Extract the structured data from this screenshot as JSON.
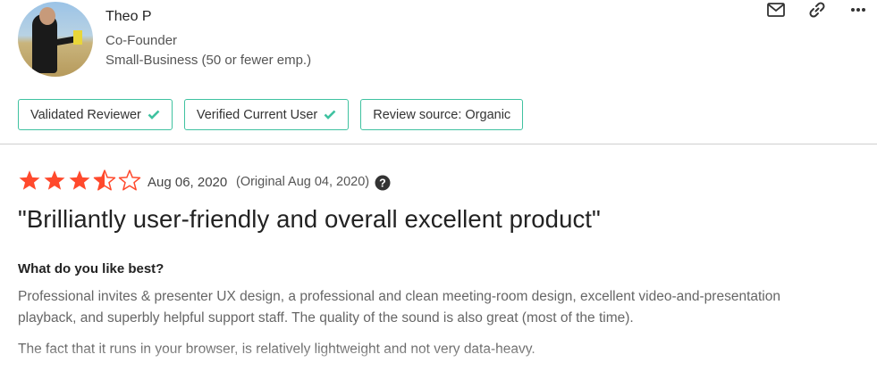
{
  "reviewer": {
    "name": "Theo P",
    "role": "Co-Founder",
    "company_size": "Small-Business (50 or fewer emp.)"
  },
  "header_icons": [
    "mail-icon",
    "link-icon",
    "more-icon"
  ],
  "badges": [
    {
      "label": "Validated Reviewer",
      "checked": true
    },
    {
      "label": "Verified Current User",
      "checked": true
    },
    {
      "label": "Review source: Organic",
      "checked": false
    }
  ],
  "review": {
    "rating": 3.5,
    "rating_max": 5,
    "date": "Aug 06, 2020",
    "original_date": "(Original Aug 04, 2020)",
    "title": "\"Brilliantly user-friendly and overall excellent product\"",
    "question": "What do you like best?",
    "answer_p1": "Professional invites & presenter UX design, a professional and clean meeting-room design, excellent video-and-presentation playback, and superbly helpful support staff. The quality of the sound is also great (most of the time).",
    "answer_p2": "The fact that it runs in your browser, is relatively lightweight and not very data-heavy."
  },
  "colors": {
    "accent": "#3fc2a0",
    "star": "#ff492c",
    "text_dark": "#222222",
    "text_muted": "#666666"
  }
}
